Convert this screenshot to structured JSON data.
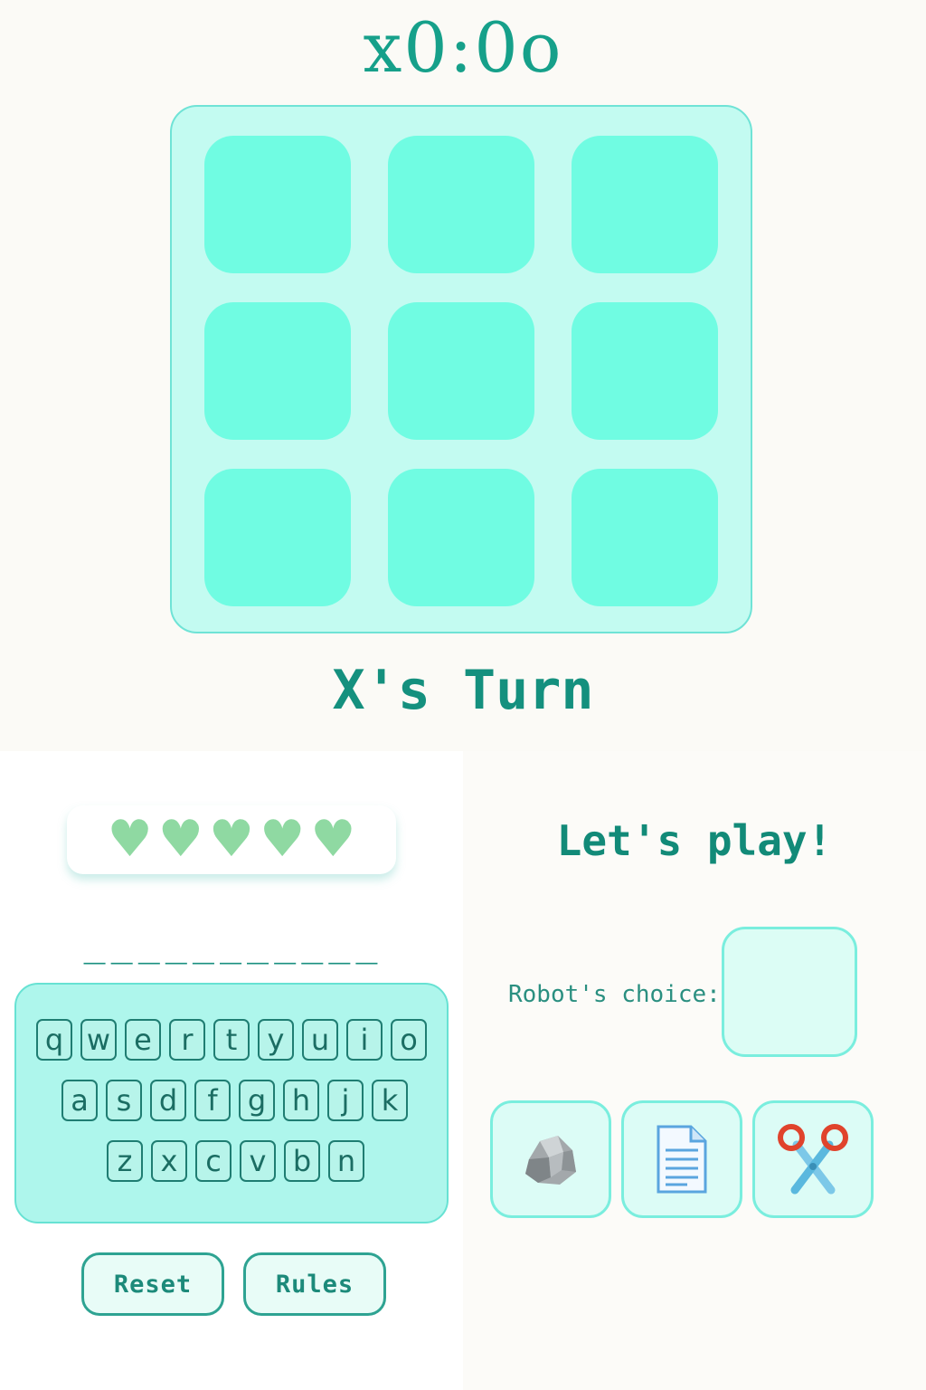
{
  "score": "x0:0o",
  "turn_status": "X's Turn",
  "board": {
    "cells": [
      "",
      "",
      "",
      "",
      "",
      "",
      "",
      "",
      ""
    ]
  },
  "lives": {
    "count": 5,
    "color": "#8fd9a2"
  },
  "word_display": "___________",
  "keyboard": {
    "rows": [
      [
        "q",
        "w",
        "e",
        "r",
        "t",
        "y",
        "u",
        "i",
        "o"
      ],
      [
        "a",
        "s",
        "d",
        "f",
        "g",
        "h",
        "j",
        "k"
      ],
      [
        "z",
        "x",
        "c",
        "v",
        "b",
        "n"
      ]
    ]
  },
  "buttons": {
    "reset": "Reset",
    "rules": "Rules"
  },
  "rps": {
    "title": "Let's play!",
    "robot_label": "Robot's choice:",
    "robot_choice": "",
    "options": [
      {
        "name": "rock",
        "icon": "rock-icon"
      },
      {
        "name": "paper",
        "icon": "paper-icon"
      },
      {
        "name": "scissors",
        "icon": "scissors-icon"
      }
    ]
  },
  "colors": {
    "accent": "#16a08a",
    "cell": "#70fce2",
    "board_bg": "#c3fbf1"
  }
}
